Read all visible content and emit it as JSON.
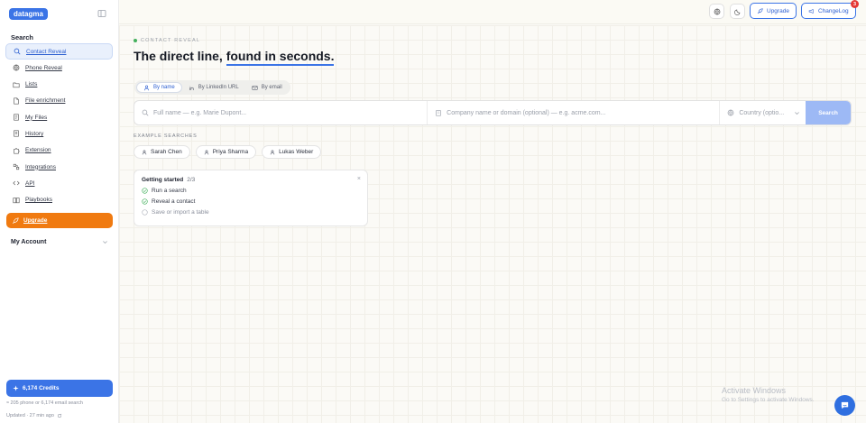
{
  "brand": {
    "logo": "datagma"
  },
  "sidebar": {
    "section_label": "Search",
    "items": [
      {
        "label": "Contact Reveal",
        "icon": "search-icon",
        "active": true
      },
      {
        "label": "Phone Reveal",
        "icon": "globe-icon"
      },
      {
        "label": "Lists",
        "icon": "folder-icon"
      },
      {
        "label": "File enrichment",
        "icon": "file-icon"
      },
      {
        "label": "My Files",
        "icon": "document-icon"
      },
      {
        "label": "History",
        "icon": "history-icon"
      },
      {
        "label": "Extension",
        "icon": "puzzle-icon"
      },
      {
        "label": "Integrations",
        "icon": "integrations-icon"
      },
      {
        "label": "API",
        "icon": "code-icon"
      },
      {
        "label": "Playbooks",
        "icon": "book-icon"
      }
    ],
    "upgrade_label": "Upgrade",
    "account_label": "My Account",
    "credits_label": "6,174 Credits",
    "credits_sub": "≈ 205 phone or 6,174 email search",
    "updated_label": "Updated · 27 min ago"
  },
  "topbar": {
    "upgrade_label": "Upgrade",
    "changelog_label": "ChangeLog",
    "changelog_badge": "3"
  },
  "main": {
    "eyebrow": "CONTACT REVEAL",
    "headline_part1": "The direct line, ",
    "headline_highlight": "found in seconds.",
    "tabs": [
      {
        "label": "By name",
        "active": true
      },
      {
        "label": "By LinkedIn URL"
      },
      {
        "label": "By email"
      }
    ],
    "search": {
      "name_placeholder": "Full name — e.g. Marie Dupont...",
      "company_placeholder": "Company name or domain (optional) — e.g. acme.com...",
      "country_placeholder": "Country (optio...",
      "button_label": "Search"
    },
    "examples_label": "EXAMPLE SEARCHES",
    "examples": [
      "Sarah Chen",
      "Priya Sharma",
      "Lukas Weber"
    ],
    "getting_started": {
      "title": "Getting started",
      "count": "2/3",
      "steps": [
        {
          "label": "Run a search",
          "done": true
        },
        {
          "label": "Reveal a contact",
          "done": true
        },
        {
          "label": "Save or import a table",
          "done": false
        }
      ]
    }
  },
  "watermark": {
    "line1": "Activate Windows",
    "line2": "Go to Settings to activate Windows."
  },
  "colors": {
    "accent": "#3b74e6",
    "upgrade": "#f07a10",
    "success": "#43b05c",
    "badge": "#e53935"
  }
}
